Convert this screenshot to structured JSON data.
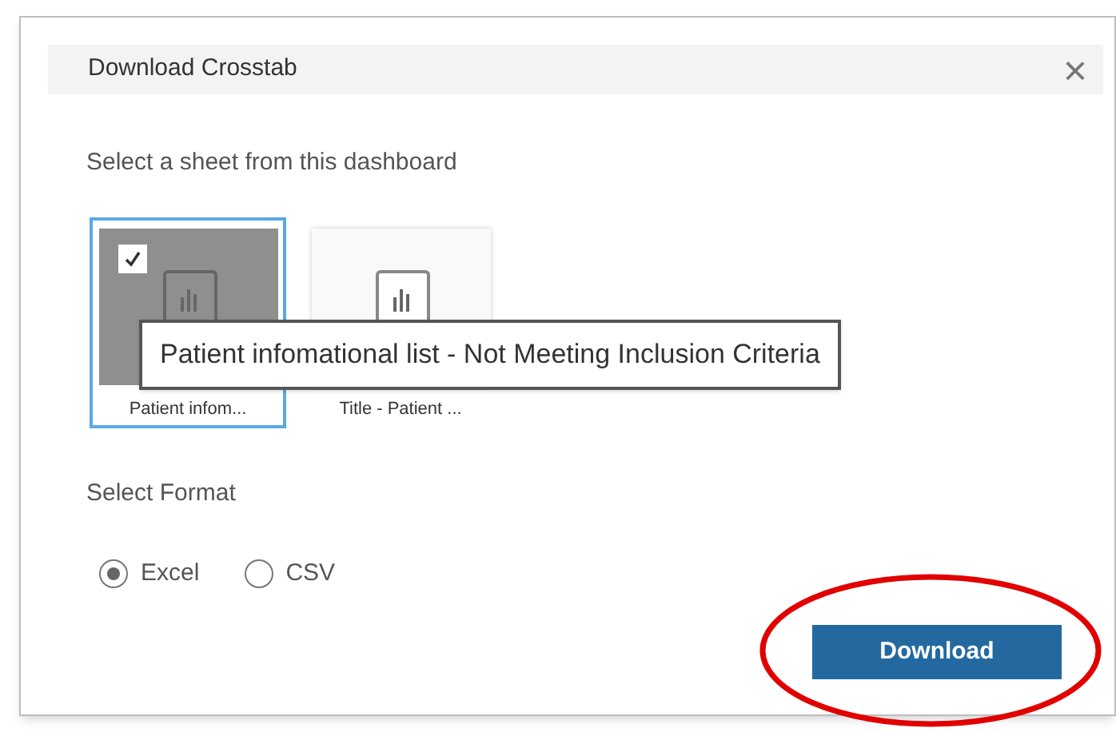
{
  "dialog": {
    "title": "Download Crosstab",
    "close": "×"
  },
  "sheet_prompt": "Select a sheet from this dashboard",
  "sheets": [
    {
      "label": "Patient infom...",
      "selected": true
    },
    {
      "label": "Title - Patient ...",
      "selected": false
    }
  ],
  "tooltip": "Patient infomational list - Not Meeting Inclusion Criteria",
  "format_label": "Select Format",
  "formats": [
    {
      "label": "Excel",
      "selected": true
    },
    {
      "label": "CSV",
      "selected": false
    }
  ],
  "download_button": "Download",
  "annotation": {
    "kind": "ellipse"
  }
}
